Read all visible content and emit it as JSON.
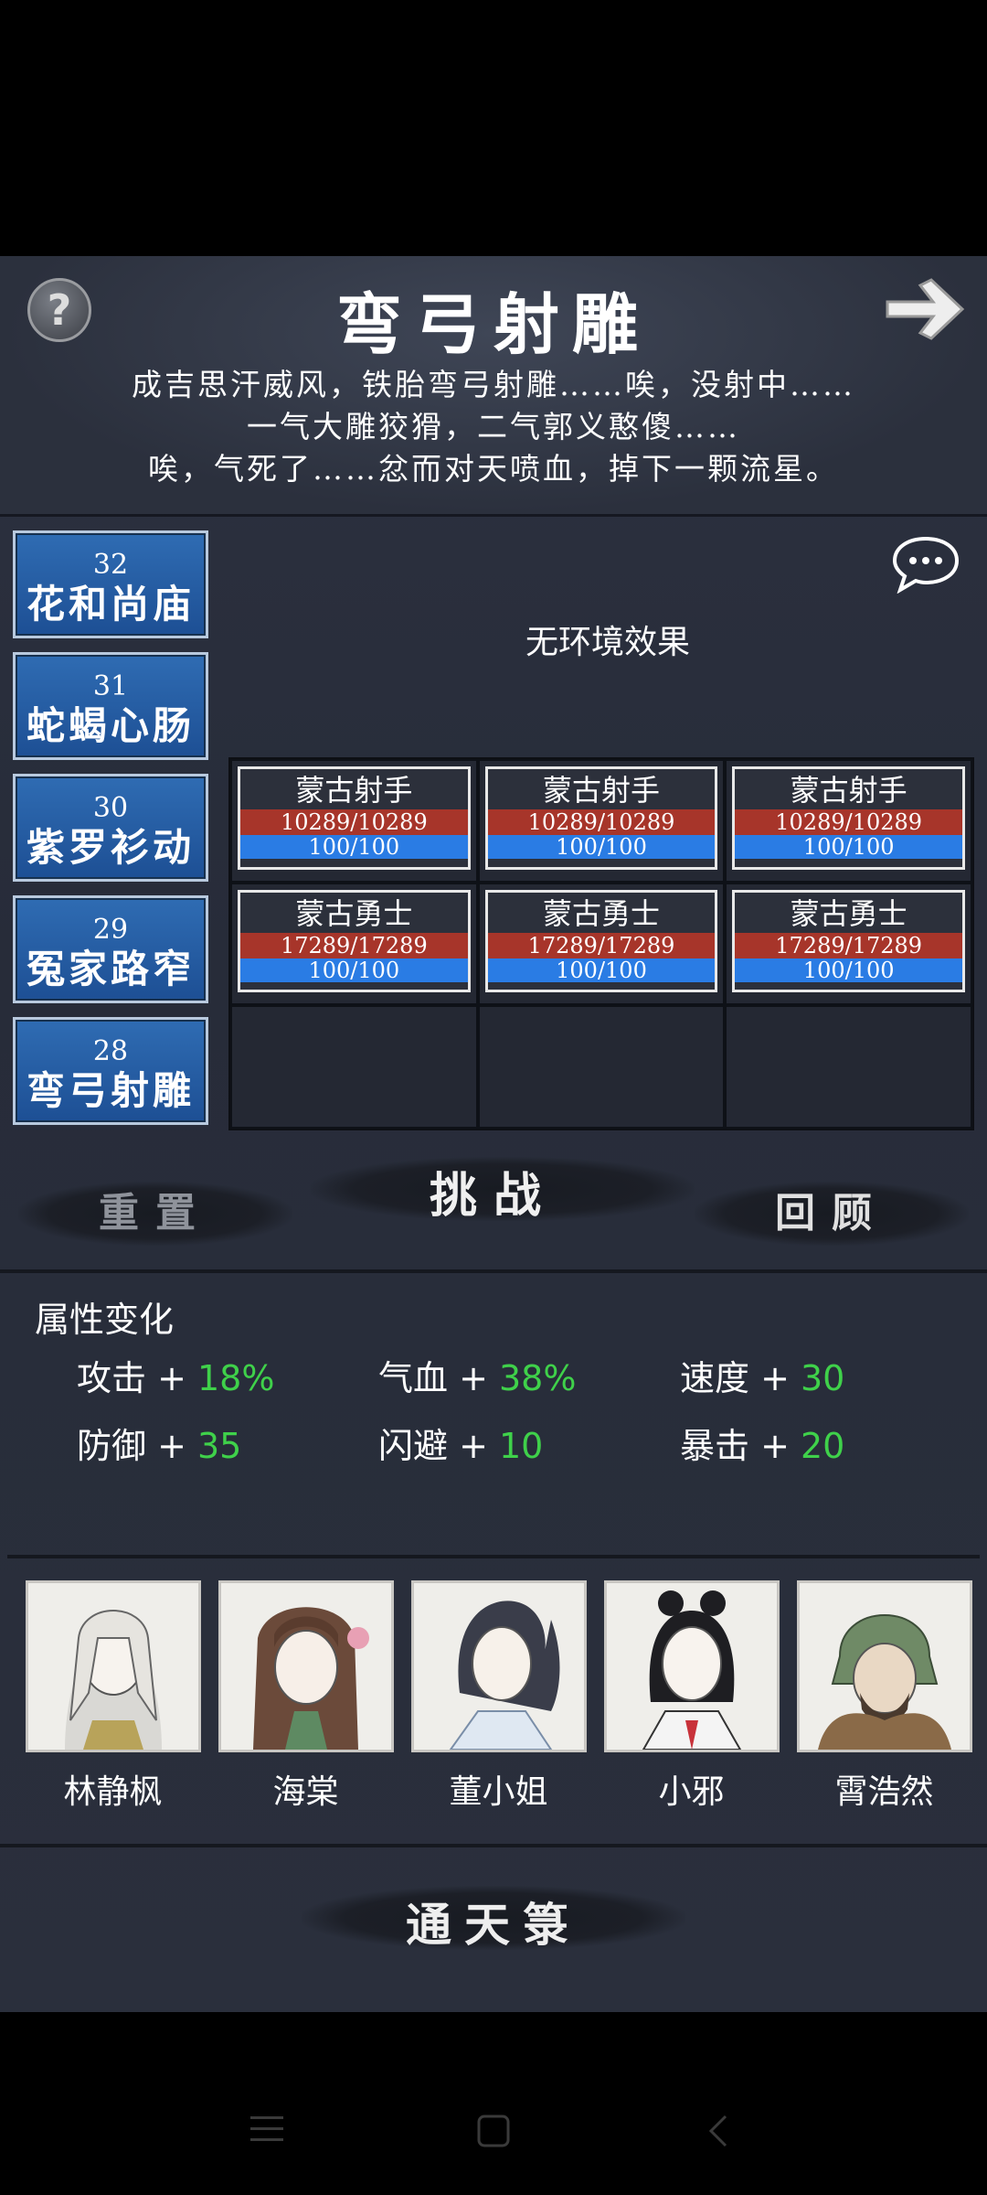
{
  "header": {
    "title": "弯弓射雕",
    "story_lines": [
      "成吉思汗威风，铁胎弯弓射雕……唉，没射中……",
      "一气大雕狡猾，二气郭义憨傻……",
      "唉，气死了……忿而对天喷血，掉下一颗流星。"
    ]
  },
  "levels": [
    {
      "num": "32",
      "name": "花和尚庙"
    },
    {
      "num": "31",
      "name": "蛇蝎心肠"
    },
    {
      "num": "30",
      "name": "紫罗衫动"
    },
    {
      "num": "29",
      "name": "冤家路窄"
    },
    {
      "num": "28",
      "name": "弯弓射雕"
    }
  ],
  "battle": {
    "environment": "无环境效果",
    "enemies": [
      {
        "name": "蒙古射手",
        "hp": "10289/10289",
        "mp": "100/100"
      },
      {
        "name": "蒙古射手",
        "hp": "10289/10289",
        "mp": "100/100"
      },
      {
        "name": "蒙古射手",
        "hp": "10289/10289",
        "mp": "100/100"
      },
      {
        "name": "蒙古勇士",
        "hp": "17289/17289",
        "mp": "100/100"
      },
      {
        "name": "蒙古勇士",
        "hp": "17289/17289",
        "mp": "100/100"
      },
      {
        "name": "蒙古勇士",
        "hp": "17289/17289",
        "mp": "100/100"
      }
    ]
  },
  "actions": {
    "reset": "重置",
    "challenge": "挑战",
    "review": "回顾"
  },
  "attributes": {
    "title": "属性变化",
    "items": [
      {
        "label": "攻击 + ",
        "value": "18%"
      },
      {
        "label": "气血 + ",
        "value": "38%"
      },
      {
        "label": "速度 + ",
        "value": "30"
      },
      {
        "label": "防御 + ",
        "value": "35"
      },
      {
        "label": "闪避 + ",
        "value": "10"
      },
      {
        "label": "暴击 + ",
        "value": "20"
      }
    ]
  },
  "party": [
    {
      "name": "林静枫"
    },
    {
      "name": "海棠"
    },
    {
      "name": "董小姐"
    },
    {
      "name": "小邪"
    },
    {
      "name": "霄浩然"
    }
  ],
  "footer": {
    "label": "通天箓"
  },
  "colors": {
    "level_blue": "#1d4f94",
    "hp_red": "#a7352a",
    "mp_blue": "#2a7ce4",
    "positive_green": "#3fd14a"
  }
}
